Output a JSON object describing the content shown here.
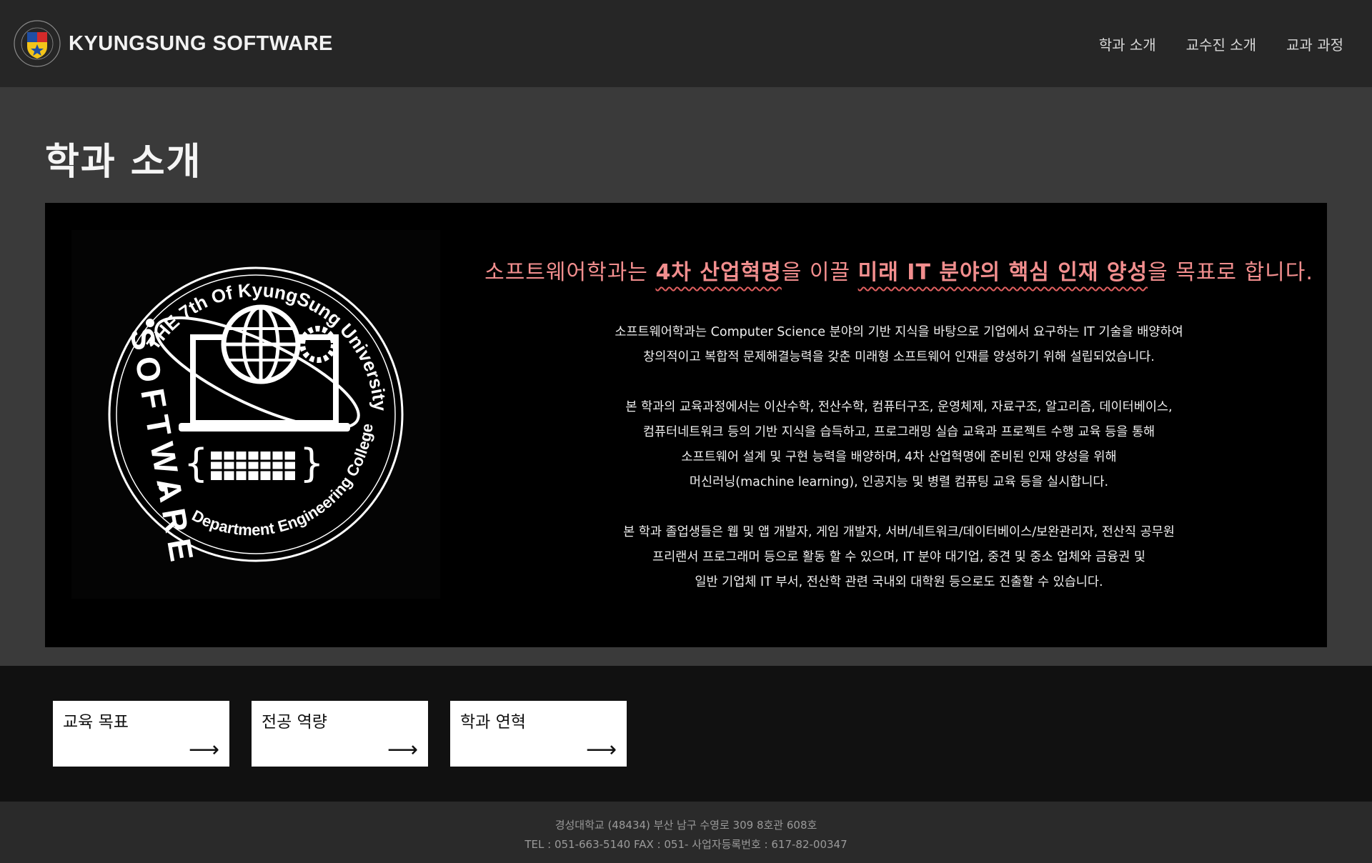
{
  "header": {
    "brand": "KYUNGSUNG SOFTWARE",
    "nav": [
      "학과 소개",
      "교수진 소개",
      "교과 과정"
    ]
  },
  "page": {
    "title": "학과 소개"
  },
  "intro": {
    "headline_pre": "소프트웨어학과는 ",
    "headline_em1": "4차 산업혁명",
    "headline_mid": "을 이끌 ",
    "headline_em2": "미래 IT 분야의 핵심 인재 양성",
    "headline_post": "을 목표로 합니다.",
    "paragraphs": [
      "소프트웨어학과는 Computer Science 분야의 기반 지식을 바탕으로 기업에서 요구하는 IT 기술을 배양하여\n창의적이고 복합적 문제해결능력을 갖춘 미래형 소프트웨어 인재를 양성하기 위해 설립되었습니다.",
      "본 학과의 교육과정에서는 이산수학, 전산수학, 컴퓨터구조, 운영체제, 자료구조, 알고리즘, 데이터베이스,\n컴퓨터네트워크 등의 기반 지식을 습득하고, 프로그래밍 실습 교육과 프로젝트 수행 교육 등을 통해\n소프트웨어 설계 및 구현 능력을 배양하며, 4차 산업혁명에 준비된 인재 양성을 위해\n머신러닝(machine learning), 인공지능 및 병렬 컴퓨팅 교육 등을 실시합니다.",
      "본 학과 졸업생들은 웹 및 앱 개발자, 게임 개발자, 서버/네트워크/데이터베이스/보완관리자, 전산직 공무원\n프리랜서 프로그래머 등으로 활동 할 수 있으며, IT 분야 대기업, 중견 및 중소 업체와 금융권 및\n일반 기업체 IT 부서, 전산학 관련 국내외 대학원 등으로도 진출할 수 있습니다."
    ],
    "emblem": {
      "ring_text": "THE 7th Of KyungSung University",
      "ring_text_bottom": "Department Engineering College",
      "word": "SOFTWARE"
    }
  },
  "cards": [
    {
      "label": "교육 목표",
      "arrow": "⟶"
    },
    {
      "label": "전공 역량",
      "arrow": "⟶"
    },
    {
      "label": "학과 연혁",
      "arrow": "⟶"
    }
  ],
  "footer": {
    "line1": "경성대학교 (48434) 부산 남구 수영로 309 8호관 608호",
    "line2": "TEL : 051-663-5140 FAX : 051- 사업자등록번호 : 617-82-00347"
  }
}
